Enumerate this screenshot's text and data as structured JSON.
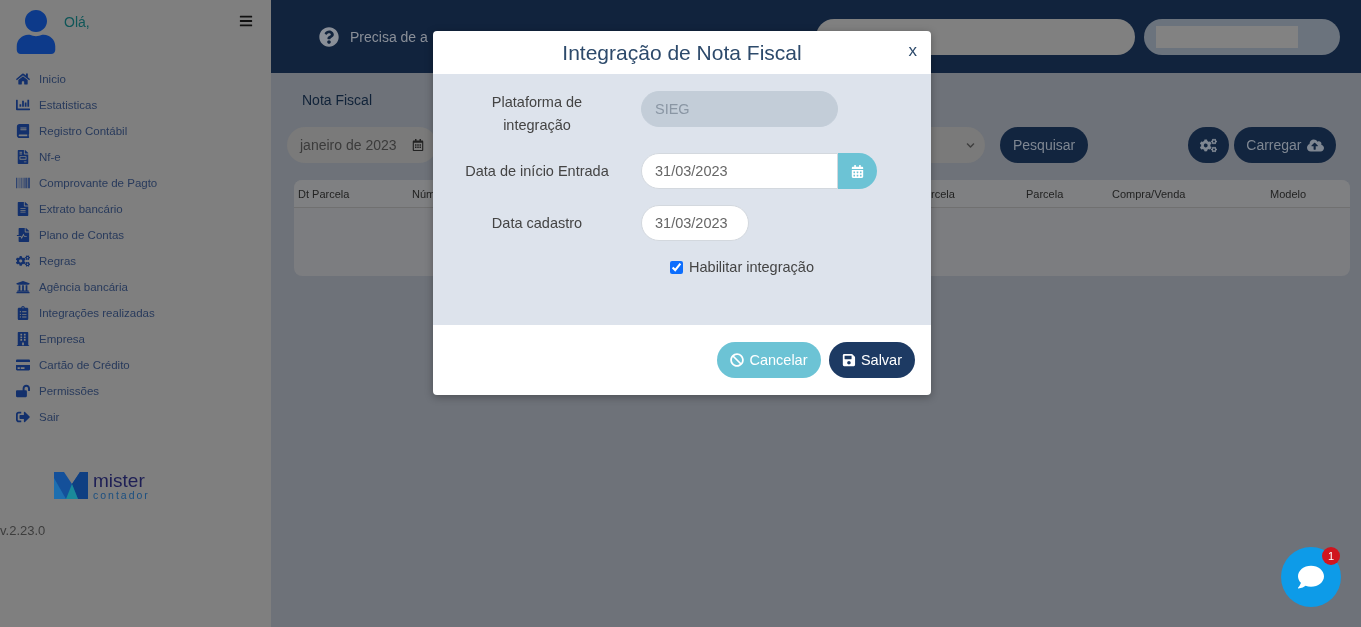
{
  "sidebar": {
    "greeting": "Olá,",
    "items": [
      {
        "label": "Inicio"
      },
      {
        "label": "Estatisticas"
      },
      {
        "label": "Registro Contábil"
      },
      {
        "label": "Nf-e"
      },
      {
        "label": "Comprovante de Pagto"
      },
      {
        "label": "Extrato bancário"
      },
      {
        "label": "Plano de Contas"
      },
      {
        "label": "Regras"
      },
      {
        "label": "Agência bancária"
      },
      {
        "label": "Integrações realizadas"
      },
      {
        "label": "Empresa"
      },
      {
        "label": "Cartão de Crédito"
      },
      {
        "label": "Permissões"
      },
      {
        "label": "Sair"
      }
    ],
    "logo": {
      "name": "mister",
      "tagline": "contador"
    },
    "version": "v.2.23.0"
  },
  "header": {
    "help_text": "Precisa de a"
  },
  "page": {
    "title": "Nota Fiscal",
    "month": "janeiro de 2023",
    "search_button": "Pesquisar",
    "upload_button": "Carregar",
    "table": {
      "columns": [
        "Dt Parcela",
        "Núm",
        "rcela",
        "Parcela",
        "Compra/Venda",
        "Modelo"
      ]
    }
  },
  "modal": {
    "title": "Integração de Nota Fiscal",
    "close": "x",
    "fields": [
      {
        "kind": "text",
        "label": "Plataforma de integração",
        "value": "SIEG",
        "disabled": true
      },
      {
        "kind": "datepicker",
        "label": "Data de início Entrada",
        "value": "31/03/2023",
        "disabled": false
      },
      {
        "kind": "date",
        "label": "Data cadastro",
        "value": "31/03/2023",
        "disabled": false
      }
    ],
    "checkbox": {
      "label": "Habilitar integração",
      "checked": true
    },
    "buttons": [
      {
        "kind": "cancel",
        "label": "Cancelar"
      },
      {
        "kind": "save",
        "label": "Salvar"
      }
    ]
  },
  "chat": {
    "badge": "1"
  }
}
